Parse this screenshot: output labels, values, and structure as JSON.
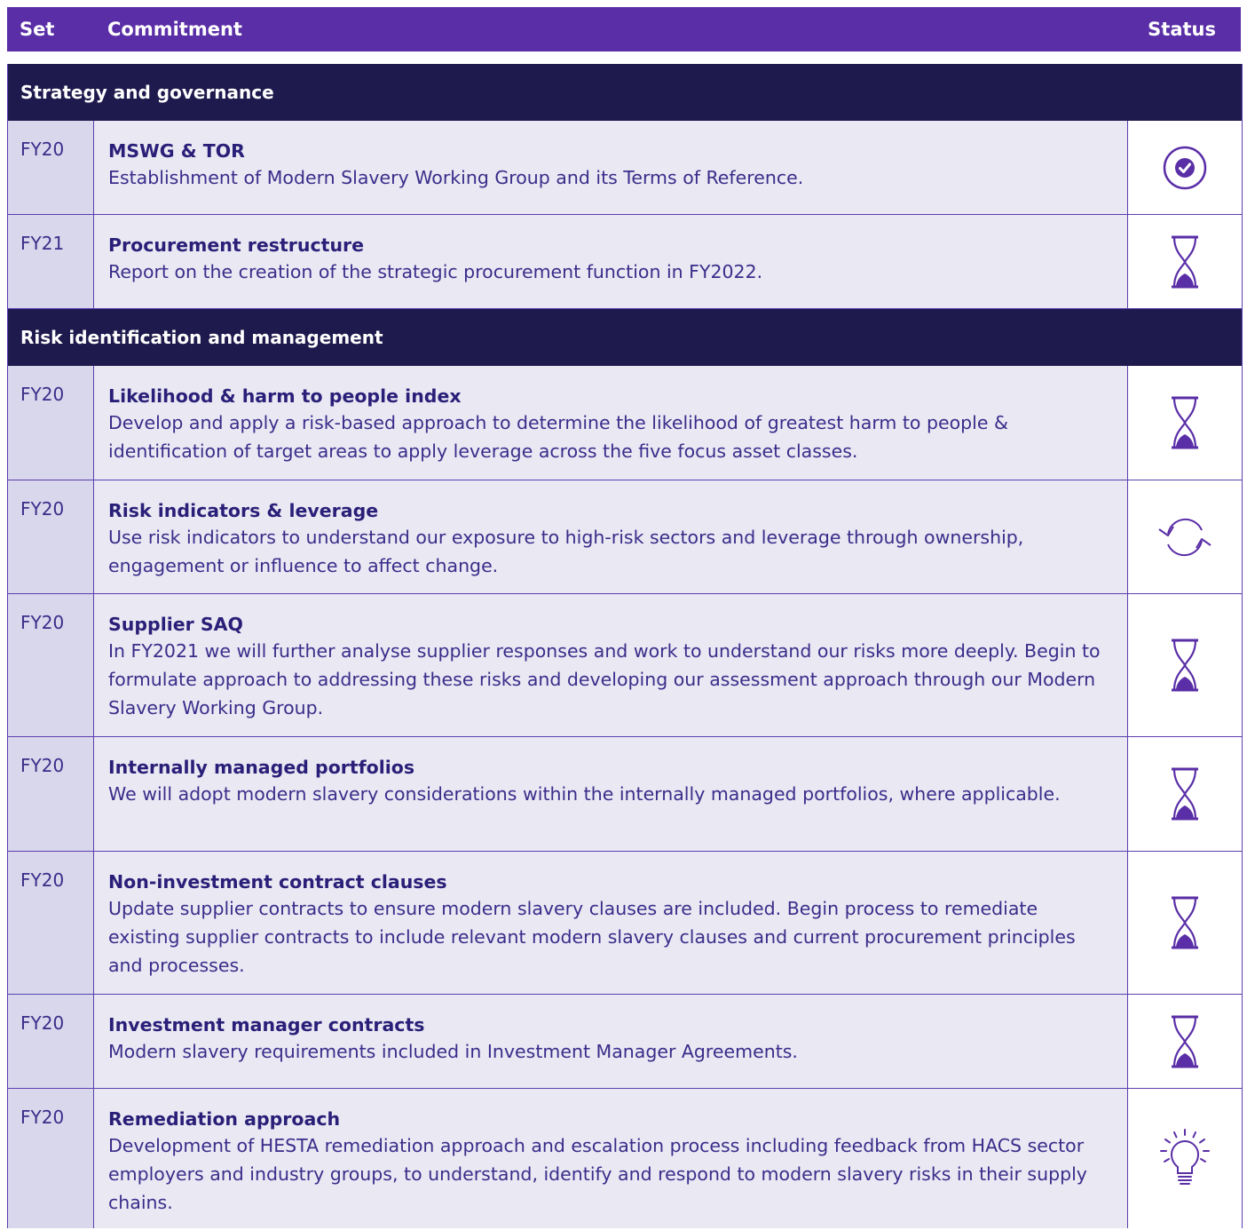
{
  "header": {
    "set": "Set",
    "commitment": "Commitment",
    "status": "Status"
  },
  "sections": [
    {
      "title": "Strategy and governance",
      "rows": [
        {
          "set": "FY20",
          "title": "MSWG & TOR",
          "desc": "Establishment of Modern Slavery Working Group and its Terms of Reference.",
          "status_icon": "check-circle-icon"
        },
        {
          "set": "FY21",
          "title": "Procurement restructure",
          "desc": "Report on the creation of the strategic procurement function in FY2022.",
          "status_icon": "hourglass-icon"
        }
      ]
    },
    {
      "title": "Risk identification and management",
      "rows": [
        {
          "set": "FY20",
          "title": "Likelihood & harm to people index",
          "desc": "Develop and apply a risk-based approach to determine the likelihood of greatest harm to people & identification of target areas to apply leverage across the five focus asset classes.",
          "status_icon": "hourglass-icon"
        },
        {
          "set": "FY20",
          "title": "Risk indicators & leverage",
          "desc": "Use risk indicators to understand our exposure to high-risk sectors and leverage through ownership, engagement or influence to affect change.",
          "status_icon": "refresh-icon"
        },
        {
          "set": "FY20",
          "title": "Supplier SAQ",
          "desc": "In FY2021 we will further analyse supplier responses and work to understand our risks more deeply. Begin to formulate approach to addressing these risks and developing our assessment approach through our Modern Slavery Working Group.",
          "status_icon": "hourglass-icon"
        },
        {
          "set": "FY20",
          "title": "Internally managed portfolios",
          "desc": "We will adopt modern slavery considerations within the internally managed portfolios, where applicable.",
          "status_icon": "hourglass-icon"
        },
        {
          "set": "FY20",
          "title": "Non-investment contract clauses",
          "desc": "Update supplier contracts to ensure modern slavery clauses are included. Begin process to remediate existing supplier contracts to include relevant modern slavery clauses and current procurement principles and processes.",
          "status_icon": "hourglass-icon"
        },
        {
          "set": "FY20",
          "title": "Investment manager contracts",
          "desc": "Modern slavery requirements included in Investment Manager Agreements.",
          "status_icon": "hourglass-icon"
        },
        {
          "set": "FY20",
          "title": "Remediation approach",
          "desc": "Development of HESTA remediation approach and escalation process including feedback from HACS sector employers and industry groups, to understand, identify and respond to modern slavery risks in their supply chains.",
          "status_icon": "lightbulb-icon"
        }
      ]
    }
  ]
}
